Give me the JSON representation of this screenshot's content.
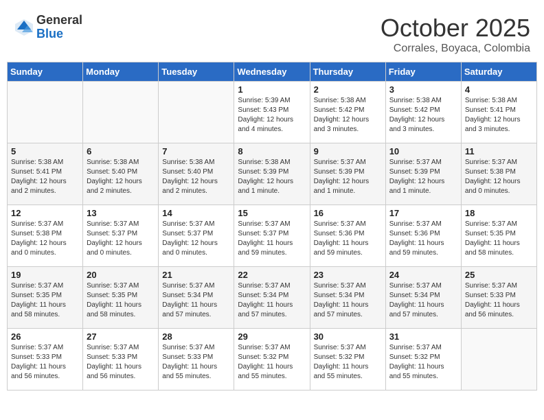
{
  "header": {
    "logo_general": "General",
    "logo_blue": "Blue",
    "month": "October 2025",
    "location": "Corrales, Boyaca, Colombia"
  },
  "weekdays": [
    "Sunday",
    "Monday",
    "Tuesday",
    "Wednesday",
    "Thursday",
    "Friday",
    "Saturday"
  ],
  "weeks": [
    [
      {
        "day": "",
        "info": ""
      },
      {
        "day": "",
        "info": ""
      },
      {
        "day": "",
        "info": ""
      },
      {
        "day": "1",
        "info": "Sunrise: 5:39 AM\nSunset: 5:43 PM\nDaylight: 12 hours\nand 4 minutes."
      },
      {
        "day": "2",
        "info": "Sunrise: 5:38 AM\nSunset: 5:42 PM\nDaylight: 12 hours\nand 3 minutes."
      },
      {
        "day": "3",
        "info": "Sunrise: 5:38 AM\nSunset: 5:42 PM\nDaylight: 12 hours\nand 3 minutes."
      },
      {
        "day": "4",
        "info": "Sunrise: 5:38 AM\nSunset: 5:41 PM\nDaylight: 12 hours\nand 3 minutes."
      }
    ],
    [
      {
        "day": "5",
        "info": "Sunrise: 5:38 AM\nSunset: 5:41 PM\nDaylight: 12 hours\nand 2 minutes."
      },
      {
        "day": "6",
        "info": "Sunrise: 5:38 AM\nSunset: 5:40 PM\nDaylight: 12 hours\nand 2 minutes."
      },
      {
        "day": "7",
        "info": "Sunrise: 5:38 AM\nSunset: 5:40 PM\nDaylight: 12 hours\nand 2 minutes."
      },
      {
        "day": "8",
        "info": "Sunrise: 5:38 AM\nSunset: 5:39 PM\nDaylight: 12 hours\nand 1 minute."
      },
      {
        "day": "9",
        "info": "Sunrise: 5:37 AM\nSunset: 5:39 PM\nDaylight: 12 hours\nand 1 minute."
      },
      {
        "day": "10",
        "info": "Sunrise: 5:37 AM\nSunset: 5:39 PM\nDaylight: 12 hours\nand 1 minute."
      },
      {
        "day": "11",
        "info": "Sunrise: 5:37 AM\nSunset: 5:38 PM\nDaylight: 12 hours\nand 0 minutes."
      }
    ],
    [
      {
        "day": "12",
        "info": "Sunrise: 5:37 AM\nSunset: 5:38 PM\nDaylight: 12 hours\nand 0 minutes."
      },
      {
        "day": "13",
        "info": "Sunrise: 5:37 AM\nSunset: 5:37 PM\nDaylight: 12 hours\nand 0 minutes."
      },
      {
        "day": "14",
        "info": "Sunrise: 5:37 AM\nSunset: 5:37 PM\nDaylight: 12 hours\nand 0 minutes."
      },
      {
        "day": "15",
        "info": "Sunrise: 5:37 AM\nSunset: 5:37 PM\nDaylight: 11 hours\nand 59 minutes."
      },
      {
        "day": "16",
        "info": "Sunrise: 5:37 AM\nSunset: 5:36 PM\nDaylight: 11 hours\nand 59 minutes."
      },
      {
        "day": "17",
        "info": "Sunrise: 5:37 AM\nSunset: 5:36 PM\nDaylight: 11 hours\nand 59 minutes."
      },
      {
        "day": "18",
        "info": "Sunrise: 5:37 AM\nSunset: 5:35 PM\nDaylight: 11 hours\nand 58 minutes."
      }
    ],
    [
      {
        "day": "19",
        "info": "Sunrise: 5:37 AM\nSunset: 5:35 PM\nDaylight: 11 hours\nand 58 minutes."
      },
      {
        "day": "20",
        "info": "Sunrise: 5:37 AM\nSunset: 5:35 PM\nDaylight: 11 hours\nand 58 minutes."
      },
      {
        "day": "21",
        "info": "Sunrise: 5:37 AM\nSunset: 5:34 PM\nDaylight: 11 hours\nand 57 minutes."
      },
      {
        "day": "22",
        "info": "Sunrise: 5:37 AM\nSunset: 5:34 PM\nDaylight: 11 hours\nand 57 minutes."
      },
      {
        "day": "23",
        "info": "Sunrise: 5:37 AM\nSunset: 5:34 PM\nDaylight: 11 hours\nand 57 minutes."
      },
      {
        "day": "24",
        "info": "Sunrise: 5:37 AM\nSunset: 5:34 PM\nDaylight: 11 hours\nand 57 minutes."
      },
      {
        "day": "25",
        "info": "Sunrise: 5:37 AM\nSunset: 5:33 PM\nDaylight: 11 hours\nand 56 minutes."
      }
    ],
    [
      {
        "day": "26",
        "info": "Sunrise: 5:37 AM\nSunset: 5:33 PM\nDaylight: 11 hours\nand 56 minutes."
      },
      {
        "day": "27",
        "info": "Sunrise: 5:37 AM\nSunset: 5:33 PM\nDaylight: 11 hours\nand 56 minutes."
      },
      {
        "day": "28",
        "info": "Sunrise: 5:37 AM\nSunset: 5:33 PM\nDaylight: 11 hours\nand 55 minutes."
      },
      {
        "day": "29",
        "info": "Sunrise: 5:37 AM\nSunset: 5:32 PM\nDaylight: 11 hours\nand 55 minutes."
      },
      {
        "day": "30",
        "info": "Sunrise: 5:37 AM\nSunset: 5:32 PM\nDaylight: 11 hours\nand 55 minutes."
      },
      {
        "day": "31",
        "info": "Sunrise: 5:37 AM\nSunset: 5:32 PM\nDaylight: 11 hours\nand 55 minutes."
      },
      {
        "day": "",
        "info": ""
      }
    ]
  ]
}
